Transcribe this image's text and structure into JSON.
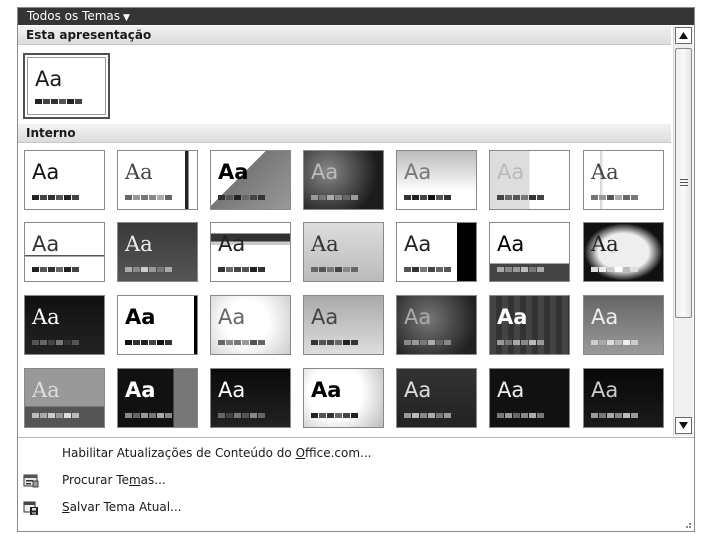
{
  "gallery": {
    "title": "Todos os Temas",
    "title_caret": "▼",
    "this_presentation_header": "Esta apresentação",
    "builtin_header": "Interno",
    "current_theme": {
      "aa": "Aa"
    },
    "themes_row1": [
      {
        "aa": "Aa"
      },
      {
        "aa": "Aa"
      },
      {
        "aa": "Aa"
      },
      {
        "aa": "Aa"
      },
      {
        "aa": "Aa"
      },
      {
        "aa": "Aa"
      },
      {
        "aa": "Aa"
      }
    ],
    "themes_row2": [
      {
        "aa": "Aa"
      },
      {
        "aa": "Aa"
      },
      {
        "aa": "Aa"
      },
      {
        "aa": "Aa"
      },
      {
        "aa": "Aa"
      },
      {
        "aa": "Aa"
      },
      {
        "aa": "Aa"
      }
    ],
    "themes_row3": [
      {
        "aa": "Aa"
      },
      {
        "aa": "Aa"
      },
      {
        "aa": "Aa"
      },
      {
        "aa": "Aa"
      },
      {
        "aa": "Aa"
      },
      {
        "aa": "Aa"
      },
      {
        "aa": "Aa"
      }
    ],
    "themes_row4": [
      {
        "aa": "Aa"
      },
      {
        "aa": "Aa"
      },
      {
        "aa": "Aa"
      },
      {
        "aa": "Aa"
      },
      {
        "aa": "Aa"
      },
      {
        "aa": "Aa"
      },
      {
        "aa": "Aa"
      }
    ]
  },
  "menu": {
    "enable_updates": {
      "before": "Habilitar Atualizações de Conteúdo do ",
      "accel": "O",
      "after": "ffice.com..."
    },
    "browse_themes": {
      "before": "Procurar Te",
      "accel": "m",
      "after": "as...",
      "icon": "folder-browse-icon"
    },
    "save_theme": {
      "before": "",
      "accel": "S",
      "after": "alvar Tema Atual...",
      "icon": "save-theme-icon"
    }
  },
  "colors": {
    "title_bar": "#353535",
    "section_header": "#e4e4e4",
    "border": "#888888"
  }
}
